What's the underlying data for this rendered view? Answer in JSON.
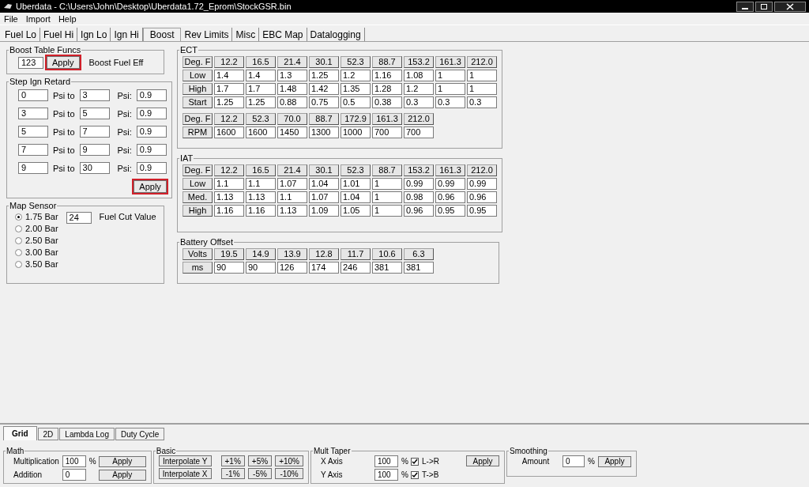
{
  "window": {
    "title": "Uberdata - C:\\Users\\John\\Desktop\\Uberdata1.72_Eprom\\StockGSR.bin"
  },
  "menu": [
    "File",
    "Import",
    "Help"
  ],
  "tabs": [
    {
      "label": "Fuel Lo",
      "selected": false
    },
    {
      "label": "Fuel Hi",
      "selected": false
    },
    {
      "label": "Ign Lo",
      "selected": false
    },
    {
      "label": "Ign Hi",
      "selected": false
    },
    {
      "label": "Boost",
      "selected": true
    },
    {
      "label": "Rev Limits",
      "selected": false
    },
    {
      "label": "Misc",
      "selected": false
    },
    {
      "label": "EBC Map",
      "selected": false
    },
    {
      "label": "Datalogging",
      "selected": false
    }
  ],
  "boost_table_funcs": {
    "title": "Boost Table Funcs",
    "value": "123",
    "apply": {
      "label": "Apply",
      "highlighted": true
    },
    "label": "Boost Fuel Eff"
  },
  "step_ign_retard": {
    "title": "Step Ign Retard",
    "rows": [
      {
        "from": "0",
        "to_label": "Psi to",
        "to": "3",
        "psi_label": "Psi:",
        "value": "0.9"
      },
      {
        "from": "3",
        "to_label": "Psi to",
        "to": "5",
        "psi_label": "Psi:",
        "value": "0.9"
      },
      {
        "from": "5",
        "to_label": "Psi to",
        "to": "7",
        "psi_label": "Psi:",
        "value": "0.9"
      },
      {
        "from": "7",
        "to_label": "Psi to",
        "to": "9",
        "psi_label": "Psi:",
        "value": "0.9"
      },
      {
        "from": "9",
        "to_label": "Psi to",
        "to": "30",
        "psi_label": "Psi:",
        "value": "0.9"
      }
    ],
    "apply": {
      "label": "Apply",
      "highlighted": true
    }
  },
  "map_sensor": {
    "title": "Map Sensor",
    "options": [
      {
        "label": "1.75 Bar",
        "selected": true
      },
      {
        "label": "2.00 Bar",
        "selected": false
      },
      {
        "label": "2.50 Bar",
        "selected": false
      },
      {
        "label": "3.00 Bar",
        "selected": false
      },
      {
        "label": "3.50 Bar",
        "selected": false
      }
    ],
    "fuel_cut": {
      "value": "24",
      "label": "Fuel Cut Value"
    }
  },
  "ect": {
    "title": "ECT",
    "tables": [
      {
        "header": [
          "Deg. F",
          "12.2",
          "16.5",
          "21.4",
          "30.1",
          "52.3",
          "88.7",
          "153.2",
          "161.3",
          "212.0"
        ],
        "rows": [
          {
            "label": "Low",
            "cells": [
              "1.4",
              "1.4",
              "1.3",
              "1.25",
              "1.2",
              "1.16",
              "1.08",
              "1",
              "1"
            ]
          },
          {
            "label": "High",
            "cells": [
              "1.7",
              "1.7",
              "1.48",
              "1.42",
              "1.35",
              "1.28",
              "1.2",
              "1",
              "1"
            ]
          },
          {
            "label": "Start",
            "cells": [
              "1.25",
              "1.25",
              "0.88",
              "0.75",
              "0.5",
              "0.38",
              "0.3",
              "0.3",
              "0.3"
            ]
          }
        ]
      },
      {
        "header": [
          "Deg. F",
          "12.2",
          "52.3",
          "70.0",
          "88.7",
          "172.9",
          "161.3",
          "212.0"
        ],
        "rows": [
          {
            "label": "RPM",
            "cells": [
              "1600",
              "1600",
              "1450",
              "1300",
              "1000",
              "700",
              "700"
            ]
          }
        ]
      }
    ]
  },
  "iat": {
    "title": "IAT",
    "tables": [
      {
        "header": [
          "Deg. F",
          "12.2",
          "16.5",
          "21.4",
          "30.1",
          "52.3",
          "88.7",
          "153.2",
          "161.3",
          "212.0"
        ],
        "rows": [
          {
            "label": "Low",
            "cells": [
              "1.1",
              "1.1",
              "1.07",
              "1.04",
              "1.01",
              "1",
              "0.99",
              "0.99",
              "0.99"
            ]
          },
          {
            "label": "Med.",
            "cells": [
              "1.13",
              "1.13",
              "1.1",
              "1.07",
              "1.04",
              "1",
              "0.98",
              "0.96",
              "0.96"
            ]
          },
          {
            "label": "High",
            "cells": [
              "1.16",
              "1.16",
              "1.13",
              "1.09",
              "1.05",
              "1",
              "0.96",
              "0.95",
              "0.95"
            ]
          }
        ]
      }
    ]
  },
  "battery_offset": {
    "title": "Battery Offset",
    "tables": [
      {
        "header": [
          "Volts",
          "19.5",
          "14.9",
          "13.9",
          "12.8",
          "11.7",
          "10.6",
          "6.3"
        ],
        "rows": [
          {
            "label": "ms",
            "cells": [
              "90",
              "90",
              "126",
              "174",
              "246",
              "381",
              "381"
            ]
          }
        ]
      }
    ]
  },
  "bottom_tabs": [
    {
      "label": "Grid",
      "selected": true
    },
    {
      "label": "2D",
      "selected": false
    },
    {
      "label": "Lambda Log",
      "selected": false
    },
    {
      "label": "Duty Cycle",
      "selected": false
    }
  ],
  "math": {
    "title": "Math",
    "rows": [
      {
        "label": "Multiplication",
        "value": "100",
        "unit": "%",
        "apply": "Apply"
      },
      {
        "label": "Addition",
        "value": "0",
        "apply": "Apply"
      }
    ]
  },
  "basic": {
    "title": "Basic",
    "rows": [
      [
        "Interpolate Y",
        "+1%",
        "+5%",
        "+10%"
      ],
      [
        "Interpolate X",
        "-1%",
        "-5%",
        "-10%"
      ]
    ]
  },
  "mult_taper": {
    "title": "Mult Taper",
    "rows": [
      {
        "label": "X Axis",
        "value": "100",
        "unit": "%",
        "checked": true,
        "check_label": "L->R"
      },
      {
        "label": "Y Axis",
        "value": "100",
        "unit": "%",
        "checked": true,
        "check_label": "T->B"
      }
    ],
    "apply": "Apply"
  },
  "smoothing": {
    "title": "Smoothing",
    "label": "Amount",
    "value": "0",
    "unit": "%",
    "apply": "Apply"
  }
}
